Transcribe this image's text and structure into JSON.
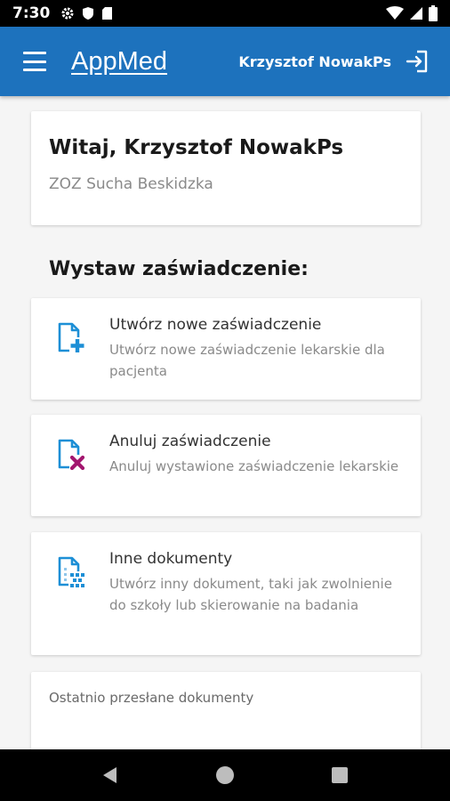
{
  "status_bar": {
    "time": "7:30",
    "left_icons": [
      "gear-icon",
      "shield-icon",
      "sd-card-icon"
    ],
    "right_icons": [
      "wifi-icon",
      "signal-icon",
      "battery-icon"
    ]
  },
  "app_bar": {
    "title": "AppMed",
    "user_name": "Krzysztof NowakPs",
    "background": "#1d72bd"
  },
  "welcome": {
    "greeting": "Witaj, Krzysztof NowakPs",
    "facility": "ZOZ Sucha Beskidzka"
  },
  "section_heading": "Wystaw zaświadczenie:",
  "actions": [
    {
      "title": "Utwórz nowe zaświadczenie",
      "description": "Utwórz nowe zaświadczenie lekarskie dla pacjenta",
      "icon": "document-add-icon",
      "accent": "#1d8fd6"
    },
    {
      "title": "Anuluj zaświadczenie",
      "description": "Anuluj wystawione zaświadczenie lekarskie",
      "icon": "document-cancel-icon",
      "accent": "#a3166f"
    },
    {
      "title": "Inne dokumenty",
      "description": "Utwórz inny dokument, taki jak zwolnienie do szkoły lub skierowanie na badania",
      "icon": "document-other-icon",
      "accent": "#1d8fd6"
    }
  ],
  "recent": {
    "title": "Ostatnio przesłane dokumenty"
  },
  "nav_bar": {
    "buttons": [
      "back-icon",
      "home-icon",
      "recents-icon"
    ]
  }
}
